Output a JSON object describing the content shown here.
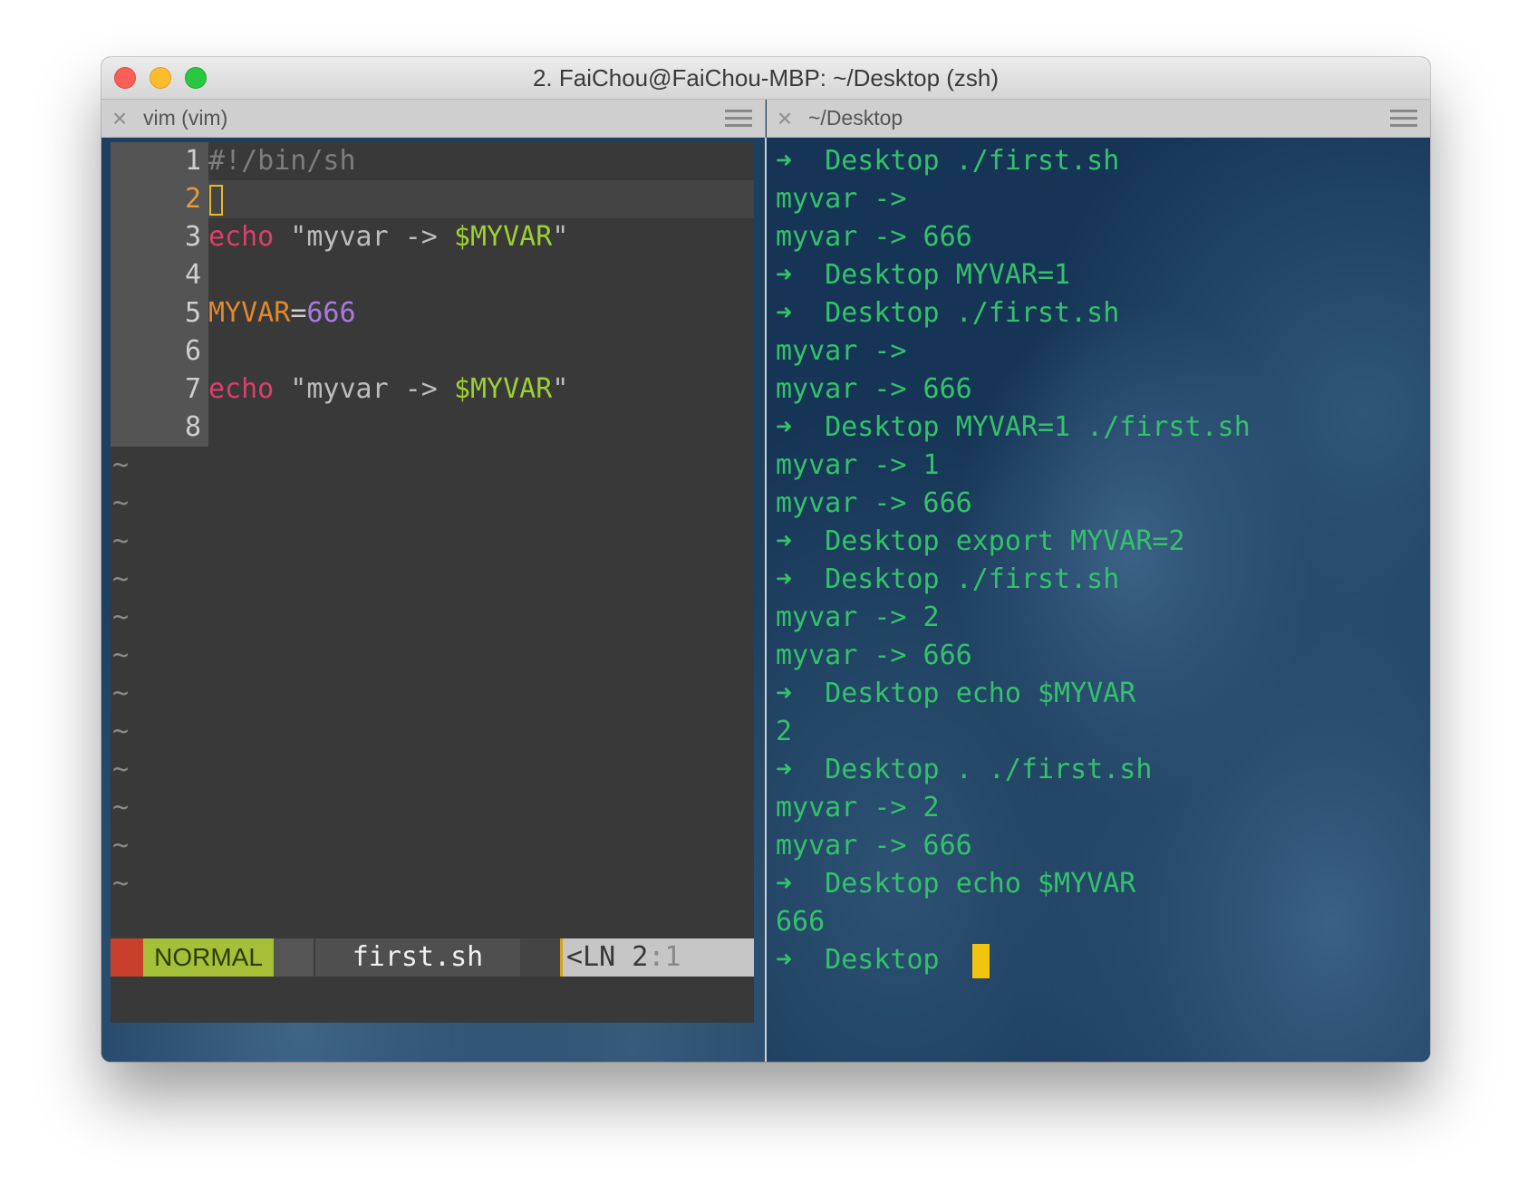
{
  "window": {
    "title": "2. FaiChou@FaiChou-MBP: ~/Desktop (zsh)"
  },
  "tabs": {
    "left": {
      "label": "vim (vim)",
      "close_icon": "×"
    },
    "right": {
      "label": "~/Desktop",
      "close_icon": "×"
    }
  },
  "vim": {
    "lines": [
      {
        "num": "1",
        "segments": [
          {
            "text": "#!/bin/sh",
            "class": "c-comment"
          }
        ]
      },
      {
        "num": "2",
        "cursor": true,
        "segments": []
      },
      {
        "num": "3",
        "segments": [
          {
            "text": "echo",
            "class": "c-keyword"
          },
          {
            "text": " \"myvar -> ",
            "class": "c-str"
          },
          {
            "text": "$MYVAR",
            "class": "c-var"
          },
          {
            "text": "\"",
            "class": "c-str"
          }
        ]
      },
      {
        "num": "4",
        "segments": []
      },
      {
        "num": "5",
        "segments": [
          {
            "text": "MYVAR",
            "class": "c-ident"
          },
          {
            "text": "=",
            "class": "c-op"
          },
          {
            "text": "666",
            "class": "c-num"
          }
        ]
      },
      {
        "num": "6",
        "segments": []
      },
      {
        "num": "7",
        "segments": [
          {
            "text": "echo",
            "class": "c-keyword"
          },
          {
            "text": " \"myvar -> ",
            "class": "c-str"
          },
          {
            "text": "$MYVAR",
            "class": "c-var"
          },
          {
            "text": "\"",
            "class": "c-str"
          }
        ]
      },
      {
        "num": "8",
        "segments": []
      }
    ],
    "tilde": "~",
    "status": {
      "mode": "NORMAL",
      "filename": "first.sh",
      "position_label": "<LN",
      "position_line": "2",
      "position_sep": ":",
      "position_col": "1"
    }
  },
  "terminal": {
    "prompt_arrow": "➜",
    "prompt_dir": "Desktop",
    "lines": [
      {
        "type": "prompt",
        "cmd": "./first.sh"
      },
      {
        "type": "out",
        "text": "myvar ->"
      },
      {
        "type": "out",
        "text": "myvar -> 666"
      },
      {
        "type": "prompt",
        "cmd": "MYVAR=1"
      },
      {
        "type": "prompt",
        "cmd": "./first.sh"
      },
      {
        "type": "out",
        "text": "myvar ->"
      },
      {
        "type": "out",
        "text": "myvar -> 666"
      },
      {
        "type": "prompt",
        "cmd": "MYVAR=1 ./first.sh"
      },
      {
        "type": "out",
        "text": "myvar -> 1"
      },
      {
        "type": "out",
        "text": "myvar -> 666"
      },
      {
        "type": "prompt",
        "cmd": "export MYVAR=2"
      },
      {
        "type": "prompt",
        "cmd": "./first.sh"
      },
      {
        "type": "out",
        "text": "myvar -> 2"
      },
      {
        "type": "out",
        "text": "myvar -> 666"
      },
      {
        "type": "prompt",
        "cmd": "echo $MYVAR"
      },
      {
        "type": "out",
        "text": "2"
      },
      {
        "type": "prompt",
        "cmd": ". ./first.sh"
      },
      {
        "type": "out",
        "text": "myvar -> 2"
      },
      {
        "type": "out",
        "text": "myvar -> 666"
      },
      {
        "type": "prompt",
        "cmd": "echo $MYVAR"
      },
      {
        "type": "out",
        "text": "666"
      },
      {
        "type": "prompt",
        "cmd": "",
        "cursor": true
      }
    ]
  },
  "colors": {
    "terminal_green": "#33c26a",
    "vim_mode_bg": "#a3c038",
    "cursor_yellow": "#f1c40f"
  }
}
